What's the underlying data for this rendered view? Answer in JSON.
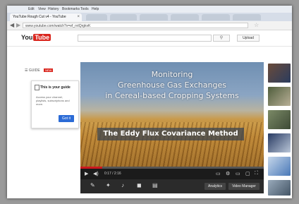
{
  "browser": {
    "menu": [
      "Edit",
      "View",
      "History",
      "Bookmarks",
      "Tools",
      "Help"
    ],
    "tab_title": "YouTube Rough Cut v4 - YouTube",
    "url": "www.youtube.com/watch?v=ef_rvtQrgkvK"
  },
  "youtube": {
    "logo_text": "You",
    "logo_badge": "Tube",
    "upload_label": "Upload",
    "search_icon": "search-icon",
    "guide_label": "GUIDE",
    "guide_badge": "NEW"
  },
  "guide_popup": {
    "title": "This is your guide",
    "body": "Access your channel, playlists, subscriptions and more.",
    "button": "Got it"
  },
  "video": {
    "title_line1": "Monitoring",
    "title_line2": "Greenhouse Gas Exchanges",
    "title_line3": "in Cereal-based Cropping Systems",
    "banner": "The Eddy Flux Covariance Method",
    "time": "0:17 / 2:16",
    "progress": 0.12
  },
  "toolbar": {
    "analytics": "Analytics",
    "video_manager": "Video Manager"
  },
  "colors": {
    "brand_red": "#d9251d",
    "player_bg": "#000000",
    "button_blue": "#2b6bd6"
  }
}
